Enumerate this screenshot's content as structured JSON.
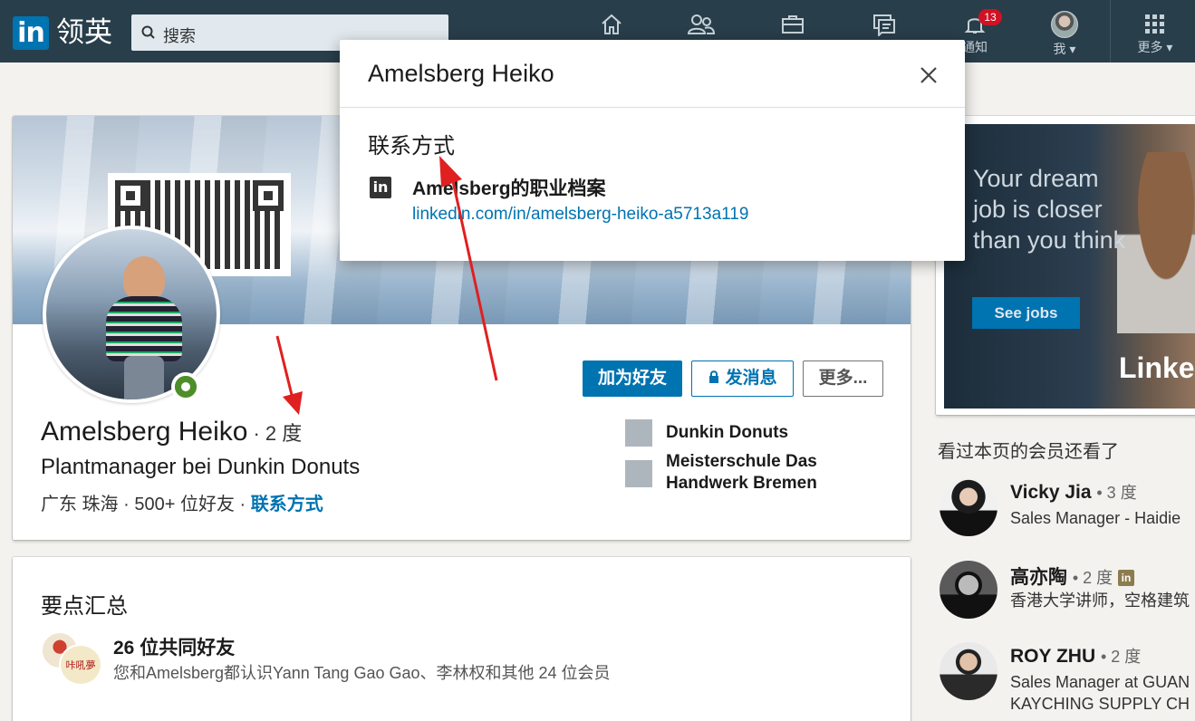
{
  "nav": {
    "logo_mark": "in",
    "logo_text": "领英",
    "search_placeholder": "搜索",
    "notifications_badge": "13",
    "notifications_label": "通知",
    "me_label": "我",
    "more_label": "更多"
  },
  "profile": {
    "name": "Amelsberg Heiko",
    "degree": "· 2 度",
    "headline": "Plantmanager bei Dunkin Donuts",
    "location": "广东 珠海",
    "connections": "500+ 位好友",
    "separator": "·",
    "contact_link": "联系方式",
    "buttons": {
      "connect": "加为好友",
      "message": "发消息",
      "more": "更多..."
    },
    "companies": [
      {
        "name": "Dunkin Donuts"
      },
      {
        "name": "Meisterschule Das",
        "name2": "Handwerk Bremen"
      }
    ]
  },
  "summary": {
    "title": "要点汇总",
    "mutual_title": "26 位共同好友",
    "mutual_sub": "您和Amelsberg都认识Yann Tang Gao Gao、李林权和其他 24 位会员",
    "mutual_img_text": "咔吼夢"
  },
  "ad": {
    "text": "Your dream job is closer than you think",
    "button": "See jobs",
    "brand": "Linke"
  },
  "rail": {
    "title": "看过本页的会员还看了",
    "people": [
      {
        "name": "Vicky Jia",
        "degree": "• 3 度",
        "subtitle": "Sales Manager - Haidie"
      },
      {
        "name": "高亦陶",
        "degree": "• 2 度",
        "subtitle": "香港大学讲师，空格建筑"
      },
      {
        "name": "ROY ZHU",
        "degree": "• 2 度",
        "subtitle": "Sales Manager at GUAN",
        "subtitle2": "KAYCHING SUPPLY CH"
      }
    ]
  },
  "modal": {
    "title": "Amelsberg Heiko",
    "section": "联系方式",
    "profile_title": "Amelsberg的职业档案",
    "profile_link": "linkedin.com/in/amelsberg-heiko-a5713a119"
  }
}
